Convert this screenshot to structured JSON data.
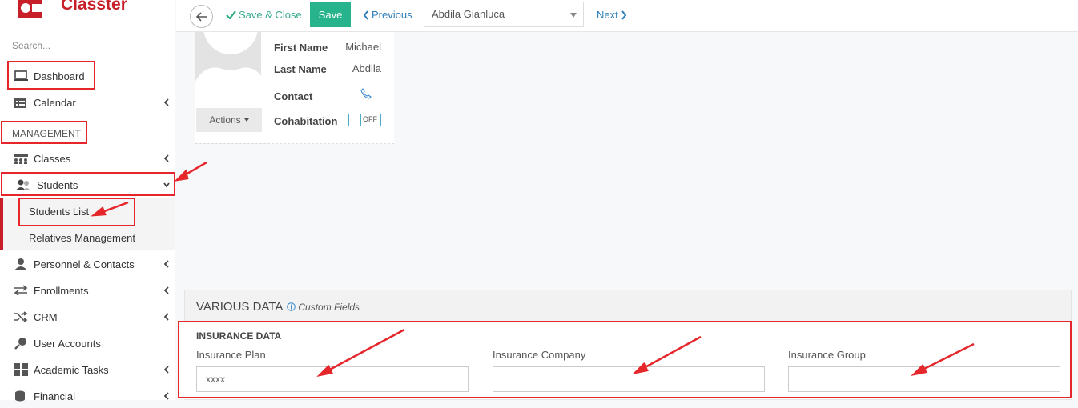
{
  "app": {
    "name": "Classter"
  },
  "sidebar": {
    "search_placeholder": "Search...",
    "section_label": "MANAGEMENT",
    "items": [
      {
        "label": "Dashboard",
        "icon": "laptop-icon"
      },
      {
        "label": "Calendar",
        "icon": "calendar-icon"
      },
      {
        "label": "Classes",
        "icon": "classes-icon"
      },
      {
        "label": "Students",
        "icon": "students-icon"
      },
      {
        "label": "Personnel & Contacts",
        "icon": "personnel-icon"
      },
      {
        "label": "Enrollments",
        "icon": "enrollments-icon"
      },
      {
        "label": "CRM",
        "icon": "crm-icon"
      },
      {
        "label": "User Accounts",
        "icon": "user-accounts-icon"
      },
      {
        "label": "Academic Tasks",
        "icon": "academic-tasks-icon"
      },
      {
        "label": "Financial",
        "icon": "financial-icon"
      }
    ],
    "sub_items": [
      {
        "label": "Students List"
      },
      {
        "label": "Relatives Management"
      }
    ]
  },
  "toolbar": {
    "save_close_label": "Save & Close",
    "save_label": "Save",
    "previous_label": "Previous",
    "record_select_value": "Abdila Gianluca",
    "next_label": "Next"
  },
  "profile": {
    "first_name_label": "First Name",
    "first_name_value": "Michael",
    "last_name_label": "Last Name",
    "last_name_value": "Abdila",
    "contact_label": "Contact",
    "cohabitation_label": "Cohabitation",
    "cohabitation_toggle": "OFF",
    "actions_label": "Actions"
  },
  "various_data": {
    "title": "VARIOUS DATA",
    "custom_fields_label": "Custom Fields",
    "insurance": {
      "section_title": "INSURANCE DATA",
      "plan_label": "Insurance Plan",
      "plan_value": "xxxx",
      "company_label": "Insurance Company",
      "company_value": "",
      "group_label": "Insurance Group",
      "group_value": ""
    }
  },
  "colors": {
    "brand_red": "#c8202b",
    "annotation_red": "#e5262b",
    "save_green": "#27b38b",
    "link_blue": "#2d7db7"
  }
}
